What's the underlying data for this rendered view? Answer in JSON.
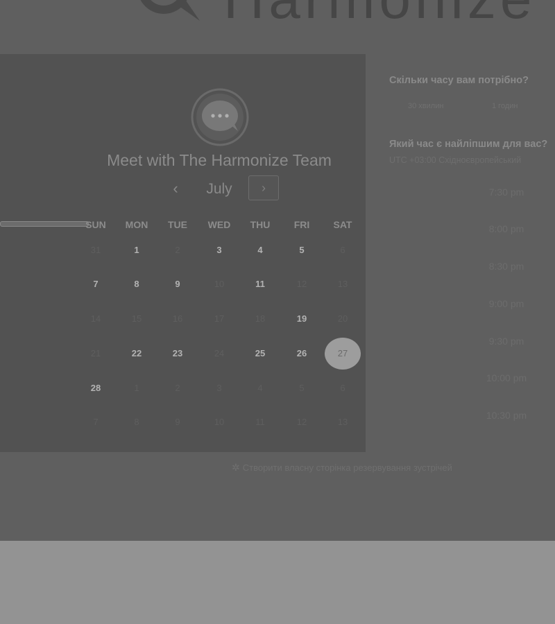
{
  "brand": {
    "name": "Harmonize",
    "logo_icon": "chat-bubble-icon"
  },
  "calendar": {
    "title": "Meet with The Harmonize Team",
    "avatar_icon": "chat-bubble-dots-icon",
    "month": "July",
    "prev_icon": "chevron-left-icon",
    "next_icon": "chevron-right-icon",
    "prev_glyph": "‹",
    "next_glyph": "›",
    "weekdays": [
      "SUN",
      "MON",
      "TUE",
      "WED",
      "THU",
      "FRI",
      "SAT"
    ],
    "weeks": [
      [
        {
          "d": "31",
          "s": "u"
        },
        {
          "d": "1",
          "s": "a"
        },
        {
          "d": "2",
          "s": "u"
        },
        {
          "d": "3",
          "s": "a"
        },
        {
          "d": "4",
          "s": "a"
        },
        {
          "d": "5",
          "s": "a"
        },
        {
          "d": "6",
          "s": "u"
        }
      ],
      [
        {
          "d": "7",
          "s": "a"
        },
        {
          "d": "8",
          "s": "a"
        },
        {
          "d": "9",
          "s": "a"
        },
        {
          "d": "10",
          "s": "u"
        },
        {
          "d": "11",
          "s": "a"
        },
        {
          "d": "12",
          "s": "u"
        },
        {
          "d": "13",
          "s": "u"
        }
      ],
      [
        {
          "d": "14",
          "s": "u"
        },
        {
          "d": "15",
          "s": "u"
        },
        {
          "d": "16",
          "s": "u"
        },
        {
          "d": "17",
          "s": "u"
        },
        {
          "d": "18",
          "s": "u"
        },
        {
          "d": "19",
          "s": "a"
        },
        {
          "d": "20",
          "s": "u"
        }
      ],
      [
        {
          "d": "21",
          "s": "u"
        },
        {
          "d": "22",
          "s": "a"
        },
        {
          "d": "23",
          "s": "a"
        },
        {
          "d": "24",
          "s": "u"
        },
        {
          "d": "25",
          "s": "a"
        },
        {
          "d": "26",
          "s": "a"
        },
        {
          "d": "27",
          "s": "selected"
        }
      ],
      [
        {
          "d": "28",
          "s": "a"
        },
        {
          "d": "1",
          "s": "u"
        },
        {
          "d": "2",
          "s": "u"
        },
        {
          "d": "3",
          "s": "u"
        },
        {
          "d": "4",
          "s": "u"
        },
        {
          "d": "5",
          "s": "u"
        },
        {
          "d": "6",
          "s": "u"
        }
      ],
      [
        {
          "d": "7",
          "s": "u"
        },
        {
          "d": "8",
          "s": "u"
        },
        {
          "d": "9",
          "s": "u"
        },
        {
          "d": "10",
          "s": "u"
        },
        {
          "d": "11",
          "s": "u"
        },
        {
          "d": "12",
          "s": "u"
        },
        {
          "d": "13",
          "s": "u"
        }
      ]
    ]
  },
  "booking": {
    "duration_question": "Скільки часу вам потрібно?",
    "duration_options": [
      "30 хвилин",
      "1 годин"
    ],
    "time_question": "Який час є найліпшим для вас?",
    "timezone": "UTC +03:00 Східноєвропейський",
    "time_slots": [
      "7:30 pm",
      "8:00 pm",
      "8:30 pm",
      "9:00 pm",
      "9:30 pm",
      "10:00 pm",
      "10:30 pm"
    ]
  },
  "footer": {
    "create_page_link": "Створити власну сторінка резервування зустрічей",
    "create_icon": "sparkle-icon"
  },
  "colors": {
    "overlay_page": "#5f5f5f",
    "card": "#525252",
    "selected_day": "#9d9d9d",
    "bottom_band": "#939393"
  }
}
